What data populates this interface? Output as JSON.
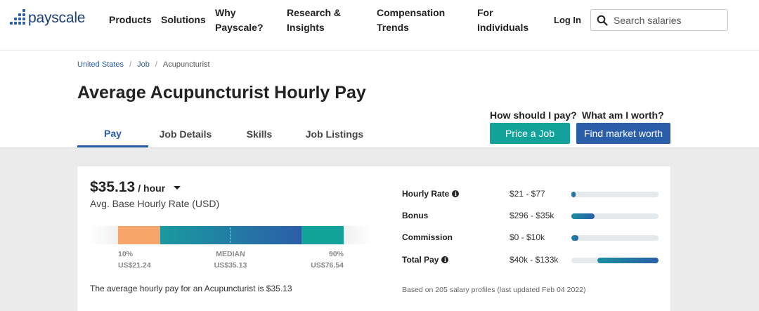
{
  "header": {
    "logo_text": "payscale",
    "nav": [
      {
        "label": "Products"
      },
      {
        "label": "Solutions"
      },
      {
        "label": "Why\nPayscale?"
      },
      {
        "label": "Research &\nInsights"
      },
      {
        "label": "Compensation\nTrends"
      },
      {
        "label": "For\nIndividuals"
      }
    ],
    "login": "Log In",
    "search_placeholder": "Search salaries"
  },
  "breadcrumb": [
    "United States",
    "Job",
    "Acupuncturist"
  ],
  "title": "Average Acupuncturist Hourly Pay",
  "cta": {
    "q1": "How should I pay?",
    "q2": "What am I worth?",
    "btn1": "Price a Job",
    "btn2": "Find market worth"
  },
  "tabs": [
    "Pay",
    "Job Details",
    "Skills",
    "Job Listings"
  ],
  "active_tab": "Pay",
  "summary_card": {
    "rate": "$35.13",
    "unit": "/ hour",
    "caption": "Avg. Base Hourly Rate (USD)",
    "percentiles": [
      {
        "label": "10%",
        "value": "US$21.24"
      },
      {
        "label": "MEDIAN",
        "value": "US$35.13"
      },
      {
        "label": "90%",
        "value": "US$76.54"
      }
    ],
    "summary_text": "The average hourly pay for an Acupuncturist is $35.13"
  },
  "pay_breakdown": [
    {
      "name": "Hourly Rate",
      "info": true,
      "range": "$21 - $77",
      "bar_start": 0.0,
      "bar_end": 0.05
    },
    {
      "name": "Bonus",
      "info": false,
      "range": "$296 - $35k",
      "bar_start": 0.0,
      "bar_end": 0.27
    },
    {
      "name": "Commission",
      "info": false,
      "range": "$0 - $10k",
      "bar_start": 0.0,
      "bar_end": 0.08
    },
    {
      "name": "Total Pay",
      "info": true,
      "range": "$40k - $133k",
      "bar_start": 0.3,
      "bar_end": 1.0
    }
  ],
  "based_on": "Based on 205 salary profiles (last updated Feb 04 2022)",
  "colors": {
    "brand_blue": "#2b5ea8",
    "teal": "#14a39b",
    "orange": "#f7a66b"
  }
}
